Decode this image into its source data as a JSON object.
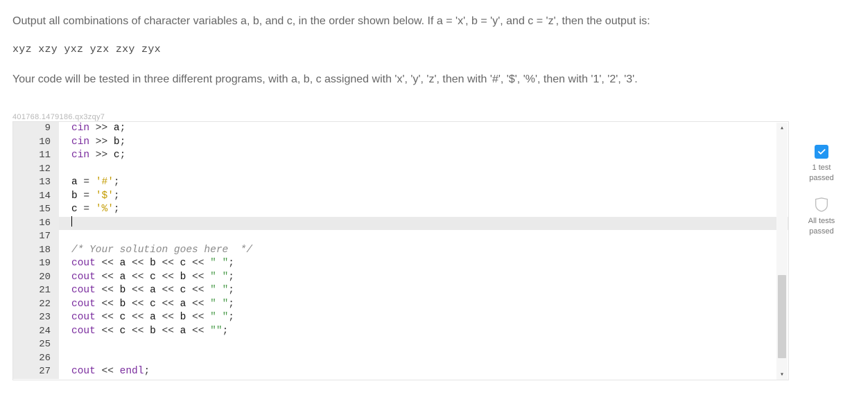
{
  "problem": {
    "p1": "Output all combinations of character variables a, b, and c, in the order shown below. If a = 'x', b = 'y', and c = 'z', then the output is:",
    "example": "xyz xzy yxz yzx zxy zyx",
    "p2": "Your code will be tested in three different programs, with a, b, c assigned with 'x', 'y', 'z', then with '#', '$', '%', then with '1', '2', '3'."
  },
  "qid": "401768.1479186.qx3zqy7",
  "editor": {
    "active_line": 16,
    "lines": [
      {
        "n": 9,
        "tokens": [
          [
            "kw",
            "cin"
          ],
          [
            "op",
            " >> "
          ],
          [
            "id",
            "a"
          ],
          [
            "op",
            ";"
          ]
        ]
      },
      {
        "n": 10,
        "tokens": [
          [
            "kw",
            "cin"
          ],
          [
            "op",
            " >> "
          ],
          [
            "id",
            "b"
          ],
          [
            "op",
            ";"
          ]
        ]
      },
      {
        "n": 11,
        "tokens": [
          [
            "kw",
            "cin"
          ],
          [
            "op",
            " >> "
          ],
          [
            "id",
            "c"
          ],
          [
            "op",
            ";"
          ]
        ]
      },
      {
        "n": 12,
        "tokens": []
      },
      {
        "n": 13,
        "tokens": [
          [
            "id",
            "a"
          ],
          [
            "op",
            " = "
          ],
          [
            "char",
            "'#'"
          ],
          [
            "op",
            ";"
          ]
        ]
      },
      {
        "n": 14,
        "tokens": [
          [
            "id",
            "b"
          ],
          [
            "op",
            " = "
          ],
          [
            "char",
            "'$'"
          ],
          [
            "op",
            ";"
          ]
        ]
      },
      {
        "n": 15,
        "tokens": [
          [
            "id",
            "c"
          ],
          [
            "op",
            " = "
          ],
          [
            "char",
            "'%'"
          ],
          [
            "op",
            ";"
          ]
        ]
      },
      {
        "n": 16,
        "tokens": []
      },
      {
        "n": 17,
        "tokens": []
      },
      {
        "n": 18,
        "tokens": [
          [
            "cmt",
            "/* Your solution goes here  */"
          ]
        ]
      },
      {
        "n": 19,
        "tokens": [
          [
            "kw",
            "cout"
          ],
          [
            "op",
            " << "
          ],
          [
            "id",
            "a"
          ],
          [
            "op",
            " << "
          ],
          [
            "id",
            "b"
          ],
          [
            "op",
            " << "
          ],
          [
            "id",
            "c"
          ],
          [
            "op",
            " << "
          ],
          [
            "str",
            "\" \""
          ],
          [
            "op",
            ";"
          ]
        ]
      },
      {
        "n": 20,
        "tokens": [
          [
            "kw",
            "cout"
          ],
          [
            "op",
            " << "
          ],
          [
            "id",
            "a"
          ],
          [
            "op",
            " << "
          ],
          [
            "id",
            "c"
          ],
          [
            "op",
            " << "
          ],
          [
            "id",
            "b"
          ],
          [
            "op",
            " << "
          ],
          [
            "str",
            "\" \""
          ],
          [
            "op",
            ";"
          ]
        ]
      },
      {
        "n": 21,
        "tokens": [
          [
            "kw",
            "cout"
          ],
          [
            "op",
            " << "
          ],
          [
            "id",
            "b"
          ],
          [
            "op",
            " << "
          ],
          [
            "id",
            "a"
          ],
          [
            "op",
            " << "
          ],
          [
            "id",
            "c"
          ],
          [
            "op",
            " << "
          ],
          [
            "str",
            "\" \""
          ],
          [
            "op",
            ";"
          ]
        ]
      },
      {
        "n": 22,
        "tokens": [
          [
            "kw",
            "cout"
          ],
          [
            "op",
            " << "
          ],
          [
            "id",
            "b"
          ],
          [
            "op",
            " << "
          ],
          [
            "id",
            "c"
          ],
          [
            "op",
            " << "
          ],
          [
            "id",
            "a"
          ],
          [
            "op",
            " << "
          ],
          [
            "str",
            "\" \""
          ],
          [
            "op",
            ";"
          ]
        ]
      },
      {
        "n": 23,
        "tokens": [
          [
            "kw",
            "cout"
          ],
          [
            "op",
            " << "
          ],
          [
            "id",
            "c"
          ],
          [
            "op",
            " << "
          ],
          [
            "id",
            "a"
          ],
          [
            "op",
            " << "
          ],
          [
            "id",
            "b"
          ],
          [
            "op",
            " << "
          ],
          [
            "str",
            "\" \""
          ],
          [
            "op",
            ";"
          ]
        ]
      },
      {
        "n": 24,
        "tokens": [
          [
            "kw",
            "cout"
          ],
          [
            "op",
            " << "
          ],
          [
            "id",
            "c"
          ],
          [
            "op",
            " << "
          ],
          [
            "id",
            "b"
          ],
          [
            "op",
            " << "
          ],
          [
            "id",
            "a"
          ],
          [
            "op",
            " << "
          ],
          [
            "str",
            "\"\""
          ],
          [
            "op",
            ";"
          ]
        ]
      },
      {
        "n": 25,
        "tokens": []
      },
      {
        "n": 26,
        "tokens": []
      },
      {
        "n": 27,
        "tokens": [
          [
            "kw",
            "cout"
          ],
          [
            "op",
            " << "
          ],
          [
            "kw",
            "endl"
          ],
          [
            "op",
            ";"
          ]
        ]
      }
    ]
  },
  "status": {
    "one_test": {
      "l1": "1 test",
      "l2": "passed"
    },
    "all_tests": {
      "l1": "All tests",
      "l2": "passed"
    }
  }
}
